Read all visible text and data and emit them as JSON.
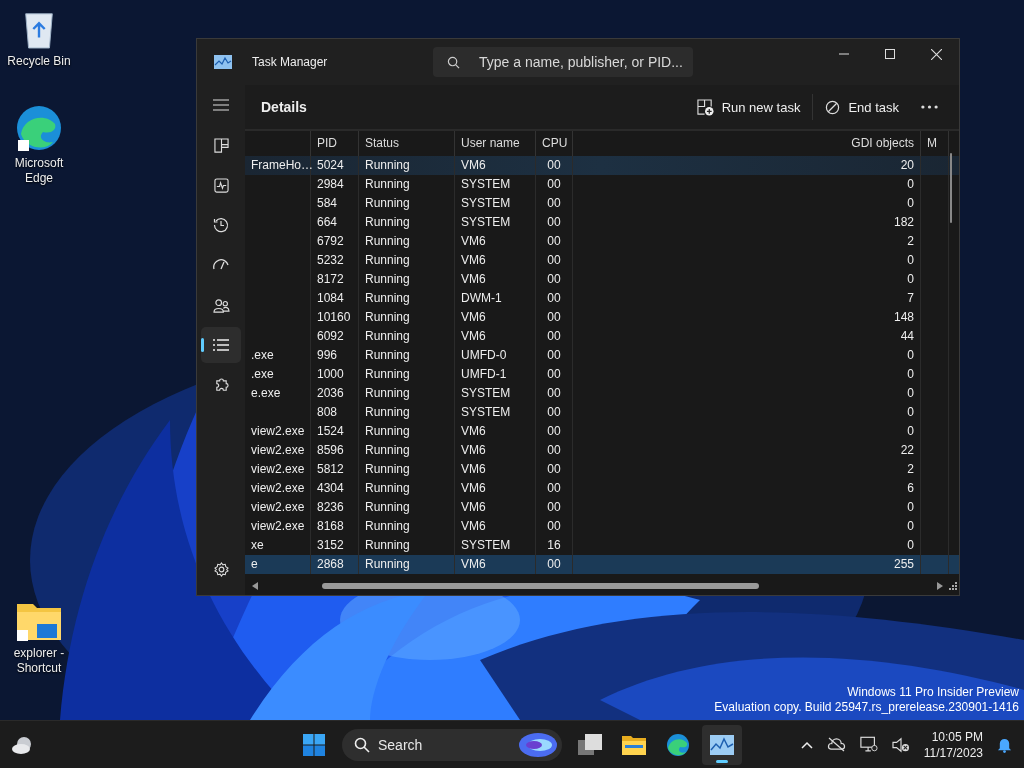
{
  "desktop_icons": [
    {
      "kind": "recycle",
      "label": "Recycle Bin"
    },
    {
      "kind": "edge",
      "label": "Microsoft Edge"
    },
    {
      "kind": "folder",
      "label": "explorer - Shortcut"
    }
  ],
  "window": {
    "title": "Task Manager",
    "search": {
      "placeholder": "Type a name, publisher, or PID..."
    },
    "nav": [
      {
        "kind": "processes",
        "selected": false
      },
      {
        "kind": "performance",
        "selected": false
      },
      {
        "kind": "history",
        "selected": false
      },
      {
        "kind": "startup",
        "selected": false
      },
      {
        "kind": "users",
        "selected": false
      },
      {
        "kind": "details",
        "selected": true
      },
      {
        "kind": "services",
        "selected": false
      }
    ],
    "page_title": "Details",
    "actions": [
      {
        "kind": "run",
        "label": "Run new task"
      },
      {
        "kind": "end",
        "label": "End task"
      }
    ],
    "table": {
      "columns": [
        "PID",
        "Status",
        "User name",
        "CPU",
        "GDI objects",
        "M"
      ],
      "rows": [
        {
          "name": "FrameHo…",
          "pid": "5024",
          "status": "Running",
          "user": "VM6",
          "cpu": "00",
          "gdi": "20",
          "hovered": true,
          "selected": false
        },
        {
          "pid": "2984",
          "status": "Running",
          "user": "SYSTEM",
          "cpu": "00",
          "gdi": "0",
          "hovered": false,
          "selected": false
        },
        {
          "pid": "584",
          "status": "Running",
          "user": "SYSTEM",
          "cpu": "00",
          "gdi": "0",
          "hovered": false,
          "selected": false
        },
        {
          "pid": "664",
          "status": "Running",
          "user": "SYSTEM",
          "cpu": "00",
          "gdi": "182",
          "hovered": false,
          "selected": false
        },
        {
          "pid": "6792",
          "status": "Running",
          "user": "VM6",
          "cpu": "00",
          "gdi": "2",
          "hovered": false,
          "selected": false
        },
        {
          "pid": "5232",
          "status": "Running",
          "user": "VM6",
          "cpu": "00",
          "gdi": "0",
          "hovered": false,
          "selected": false
        },
        {
          "pid": "8172",
          "status": "Running",
          "user": "VM6",
          "cpu": "00",
          "gdi": "0",
          "hovered": false,
          "selected": false
        },
        {
          "pid": "1084",
          "status": "Running",
          "user": "DWM-1",
          "cpu": "00",
          "gdi": "7",
          "hovered": false,
          "selected": false
        },
        {
          "pid": "10160",
          "status": "Running",
          "user": "VM6",
          "cpu": "00",
          "gdi": "148",
          "hovered": false,
          "selected": false
        },
        {
          "pid": "6092",
          "status": "Running",
          "user": "VM6",
          "cpu": "00",
          "gdi": "44",
          "hovered": false,
          "selected": false
        },
        {
          "name": ".exe",
          "pid": "996",
          "status": "Running",
          "user": "UMFD-0",
          "cpu": "00",
          "gdi": "0",
          "hovered": false,
          "selected": false
        },
        {
          "name": ".exe",
          "pid": "1000",
          "status": "Running",
          "user": "UMFD-1",
          "cpu": "00",
          "gdi": "0",
          "hovered": false,
          "selected": false
        },
        {
          "name": "e.exe",
          "pid": "2036",
          "status": "Running",
          "user": "SYSTEM",
          "cpu": "00",
          "gdi": "0",
          "hovered": false,
          "selected": false
        },
        {
          "pid": "808",
          "status": "Running",
          "user": "SYSTEM",
          "cpu": "00",
          "gdi": "0",
          "hovered": false,
          "selected": false
        },
        {
          "name": "view2.exe",
          "pid": "1524",
          "status": "Running",
          "user": "VM6",
          "cpu": "00",
          "gdi": "0",
          "hovered": false,
          "selected": false
        },
        {
          "name": "view2.exe",
          "pid": "8596",
          "status": "Running",
          "user": "VM6",
          "cpu": "00",
          "gdi": "22",
          "hovered": false,
          "selected": false
        },
        {
          "name": "view2.exe",
          "pid": "5812",
          "status": "Running",
          "user": "VM6",
          "cpu": "00",
          "gdi": "2",
          "hovered": false,
          "selected": false
        },
        {
          "name": "view2.exe",
          "pid": "4304",
          "status": "Running",
          "user": "VM6",
          "cpu": "00",
          "gdi": "6",
          "hovered": false,
          "selected": false
        },
        {
          "name": "view2.exe",
          "pid": "8236",
          "status": "Running",
          "user": "VM6",
          "cpu": "00",
          "gdi": "0",
          "hovered": false,
          "selected": false
        },
        {
          "name": "view2.exe",
          "pid": "8168",
          "status": "Running",
          "user": "VM6",
          "cpu": "00",
          "gdi": "0",
          "hovered": false,
          "selected": false
        },
        {
          "name": "xe",
          "pid": "3152",
          "status": "Running",
          "user": "SYSTEM",
          "cpu": "16",
          "gdi": "0",
          "hovered": false,
          "selected": false
        },
        {
          "name": "e",
          "pid": "2868",
          "status": "Running",
          "user": "VM6",
          "cpu": "00",
          "gdi": "255",
          "hovered": false,
          "selected": true
        }
      ]
    }
  },
  "watermark": [
    "Windows 11 Pro Insider Preview",
    "Evaluation copy. Build 25947.rs_prerelease.230901-1416"
  ],
  "taskbar": {
    "search": {
      "placeholder": "Search"
    },
    "apps": [
      {
        "kind": "taskview",
        "active": false
      },
      {
        "kind": "folder",
        "active": false
      },
      {
        "kind": "edge",
        "active": false
      },
      {
        "kind": "taskmgr",
        "active": true
      }
    ],
    "time": "10:05 PM",
    "date": "11/17/2023"
  }
}
